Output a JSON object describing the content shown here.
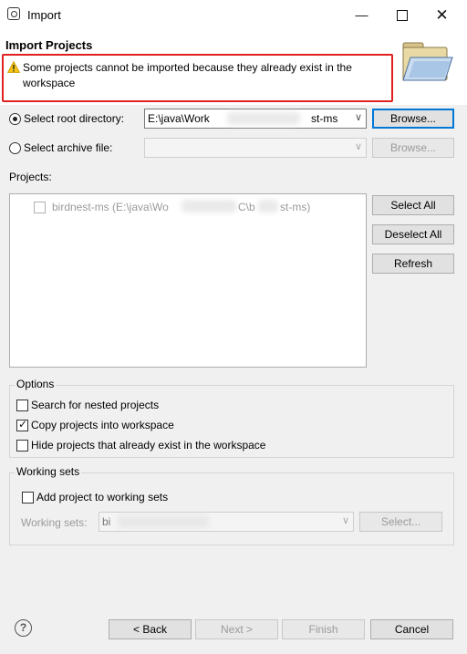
{
  "window": {
    "title": "Import"
  },
  "header": {
    "title": "Import Projects",
    "warning": "Some projects cannot be imported because they already exist in the workspace"
  },
  "root_dir": {
    "label": "Select root directory:",
    "value": "E:\\java\\Work",
    "value_tail": "st-ms",
    "browse": "Browse..."
  },
  "archive": {
    "label": "Select archive file:",
    "value": "",
    "browse": "Browse..."
  },
  "projects": {
    "label": "Projects:",
    "items": [
      {
        "name": "birdnest-ms (E:\\java\\Wo",
        "name_tail": "C\\b",
        "name_end": "st-ms)",
        "checked": false,
        "disabled": true
      }
    ],
    "select_all": "Select All",
    "deselect_all": "Deselect All",
    "refresh": "Refresh"
  },
  "options": {
    "title": "Options",
    "nested": "Search for nested projects",
    "copy": "Copy projects into workspace",
    "hide": "Hide projects that already exist in the workspace"
  },
  "working_sets": {
    "title": "Working sets",
    "add": "Add project to working sets",
    "label": "Working sets:",
    "value": "bi",
    "select": "Select..."
  },
  "footer": {
    "help": "?",
    "back": "< Back",
    "next": "Next >",
    "finish": "Finish",
    "cancel": "Cancel"
  }
}
